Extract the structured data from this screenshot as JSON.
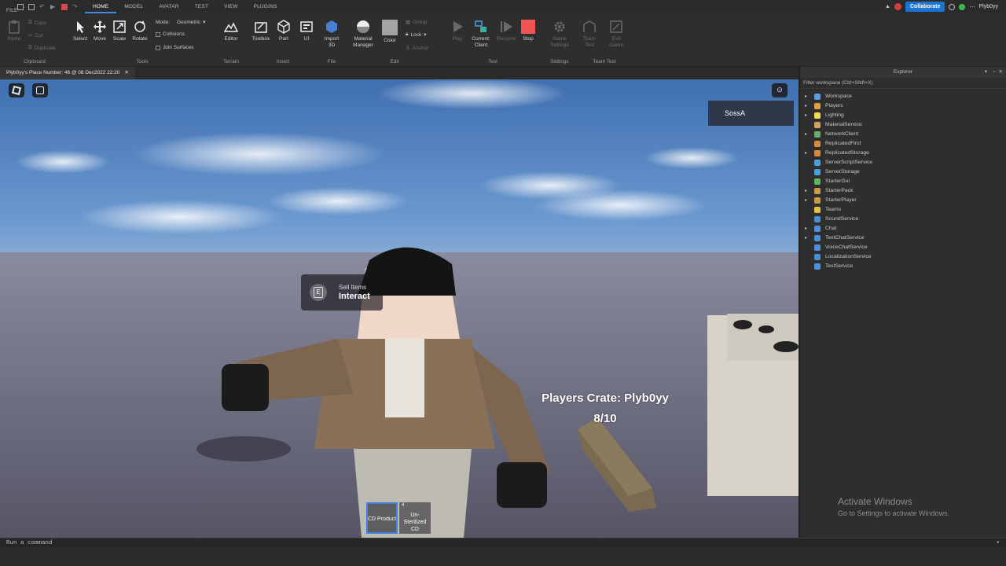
{
  "menu": {
    "file": "FILE",
    "tabs": [
      "HOME",
      "MODEL",
      "AVATAR",
      "TEST",
      "VIEW",
      "PLUGINS"
    ],
    "active_tab": "HOME"
  },
  "topright": {
    "collaborate": "Collaborate",
    "user": "Plyb0yy"
  },
  "ribbon": {
    "clipboard": {
      "paste": "Paste",
      "copy": "Copy",
      "cut": "Cut",
      "duplicate": "Duplicate",
      "label": "Clipboard"
    },
    "tools": {
      "select": "Select",
      "move": "Move",
      "scale": "Scale",
      "rotate": "Rotate",
      "mode_label": "Mode:",
      "mode_value": "Geometric",
      "collisions": "Collisions",
      "join": "Join Surfaces",
      "label": "Tools"
    },
    "terrain": {
      "editor": "Editor",
      "label": "Terrain"
    },
    "insert": {
      "toolbox": "Toolbox",
      "part": "Part",
      "ui": "UI",
      "label": "Insert"
    },
    "file": {
      "import": "Import 3D",
      "label": "File"
    },
    "edit": {
      "material": "Material Manager",
      "color": "Color",
      "group": "Group",
      "lock": "Lock",
      "anchor": "Anchor",
      "label": "Edit"
    },
    "test": {
      "play": "Play",
      "current": "Current: Client",
      "resume": "Resume",
      "stop": "Stop",
      "label": "Test"
    },
    "settings": {
      "game": "Game Settings",
      "label": "Settings"
    },
    "teamtest": {
      "team": "Team Test",
      "exit": "Exit Game",
      "label": "Team Test"
    }
  },
  "document_tab": "Plyb0yy's Place Number: 46 @ 08 Dec2022 22:20",
  "viewport": {
    "leaderboard_name": "SossA",
    "prompt_key": "E",
    "prompt_object": "Sell Items",
    "prompt_action": "Interact",
    "crate_title": "Players Crate: Plyb0yy",
    "crate_count": "8/10",
    "hotbar": [
      {
        "number": "",
        "label": "CD Product"
      },
      {
        "number": "4",
        "label": "Un-Sterilized CD"
      }
    ]
  },
  "explorer": {
    "title": "Explorer",
    "filter": "Filter workspace (Ctrl+Shift+X)",
    "items": [
      {
        "label": "Workspace",
        "expand": true,
        "color": "#5aa0e0"
      },
      {
        "label": "Players",
        "expand": true,
        "color": "#e0a040"
      },
      {
        "label": "Lighting",
        "expand": true,
        "color": "#f2d94e"
      },
      {
        "label": "MaterialService",
        "expand": false,
        "color": "#d0a060"
      },
      {
        "label": "NetworkClient",
        "expand": true,
        "color": "#6ab06a"
      },
      {
        "label": "ReplicatedFirst",
        "expand": false,
        "color": "#d88a3a"
      },
      {
        "label": "ReplicatedStorage",
        "expand": true,
        "color": "#d88a3a"
      },
      {
        "label": "ServerScriptService",
        "expand": false,
        "color": "#4aa0d8"
      },
      {
        "label": "ServerStorage",
        "expand": false,
        "color": "#4aa0d8"
      },
      {
        "label": "StarterGui",
        "expand": false,
        "color": "#5ab85a"
      },
      {
        "label": "StarterPack",
        "expand": true,
        "color": "#c89a4a"
      },
      {
        "label": "StarterPlayer",
        "expand": true,
        "color": "#c89a4a"
      },
      {
        "label": "Teams",
        "expand": false,
        "color": "#e0c040"
      },
      {
        "label": "SoundService",
        "expand": false,
        "color": "#4a90d8"
      },
      {
        "label": "Chat",
        "expand": true,
        "color": "#4a90d8"
      },
      {
        "label": "TextChatService",
        "expand": true,
        "color": "#4a90d8"
      },
      {
        "label": "VoiceChatService",
        "expand": false,
        "color": "#4a90d8"
      },
      {
        "label": "LocalizationService",
        "expand": false,
        "color": "#4a90d8"
      },
      {
        "label": "TestService",
        "expand": false,
        "color": "#4a90d8"
      }
    ]
  },
  "watermark": {
    "line1": "Activate Windows",
    "line2": "Go to Settings to activate Windows."
  },
  "command_placeholder": "Run a command"
}
